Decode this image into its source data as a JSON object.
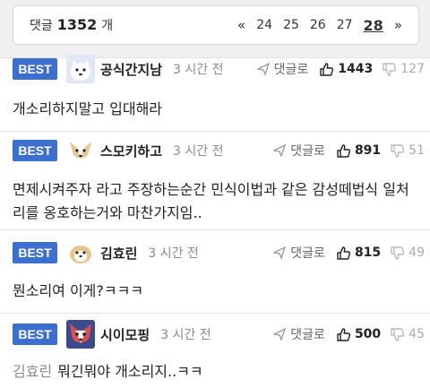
{
  "pager": {
    "count_label": "댓글",
    "count": "1352",
    "count_unit": "개",
    "prev": "«",
    "pages": [
      "24",
      "25",
      "26",
      "27"
    ],
    "current": "28",
    "next": "»"
  },
  "comments": [
    {
      "badge": "BEST",
      "nick": "공식간지남",
      "time": "3 시간 전",
      "reply": "댓글로",
      "likes": "1443",
      "dislikes": "127",
      "text": "개소리하지말고 입대해라",
      "mention": ""
    },
    {
      "badge": "BEST",
      "nick": "스모키하고",
      "time": "3 시간 전",
      "reply": "댓글로",
      "likes": "891",
      "dislikes": "51",
      "text": "면제시켜주자 라고 주장하는순간 민식이법과 같은 감성떼법식 일처리를 옹호하는거와 마찬가지임..",
      "mention": ""
    },
    {
      "badge": "BEST",
      "nick": "김효린",
      "time": "3 시간 전",
      "reply": "댓글로",
      "likes": "815",
      "dislikes": "49",
      "text": "뭔소리여 이게?ㅋㅋㅋ",
      "mention": ""
    },
    {
      "badge": "BEST",
      "nick": "시이모핑",
      "time": "3 시간 전",
      "reply": "댓글로",
      "likes": "500",
      "dislikes": "45",
      "text": "뭐긴뭐야 개소리지..ㅋㅋ",
      "mention": "김효린"
    }
  ]
}
